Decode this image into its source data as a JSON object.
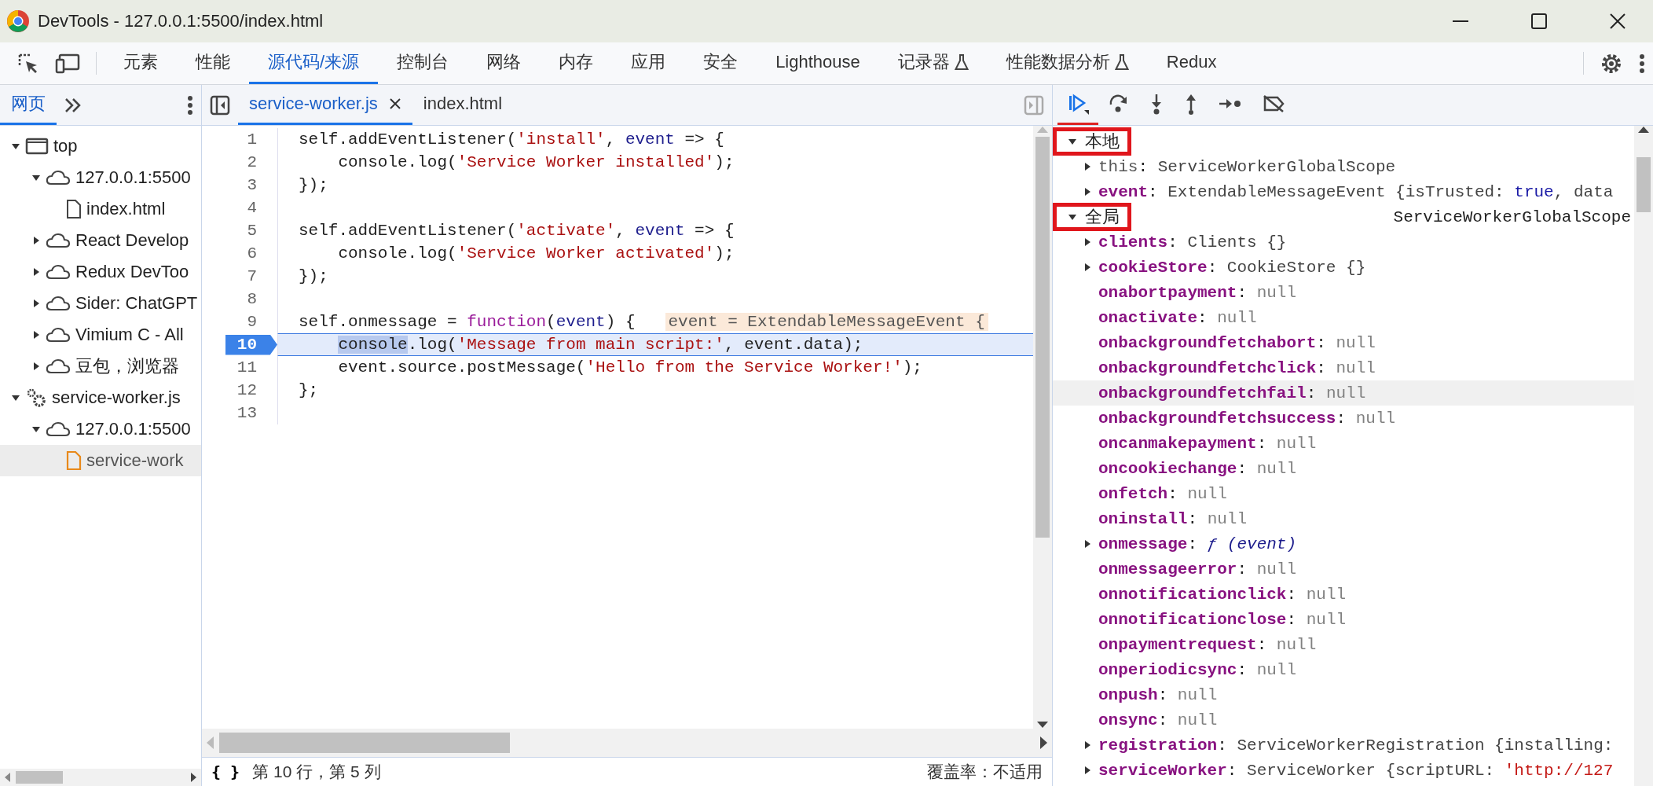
{
  "window": {
    "title": "DevTools - 127.0.0.1:5500/index.html"
  },
  "main_tabs": [
    {
      "label": "元素",
      "selected": false,
      "experimental": false
    },
    {
      "label": "性能",
      "selected": false,
      "experimental": false
    },
    {
      "label": "源代码/来源",
      "selected": true,
      "experimental": false
    },
    {
      "label": "控制台",
      "selected": false,
      "experimental": false
    },
    {
      "label": "网络",
      "selected": false,
      "experimental": false
    },
    {
      "label": "内存",
      "selected": false,
      "experimental": false
    },
    {
      "label": "应用",
      "selected": false,
      "experimental": false
    },
    {
      "label": "安全",
      "selected": false,
      "experimental": false
    },
    {
      "label": "Lighthouse",
      "selected": false,
      "experimental": false
    },
    {
      "label": "记录器",
      "selected": false,
      "experimental": true
    },
    {
      "label": "性能数据分析",
      "selected": false,
      "experimental": true
    },
    {
      "label": "Redux",
      "selected": false,
      "experimental": false
    }
  ],
  "navigator": {
    "tabs": [
      {
        "label": "网页",
        "selected": true
      }
    ],
    "tree": [
      {
        "label": "top",
        "kind": "frame",
        "expanded": true,
        "selected": false,
        "children": [
          {
            "label": "127.0.0.1:5500",
            "kind": "origin",
            "expanded": true,
            "selected": false,
            "children": [
              {
                "label": "index.html",
                "kind": "document",
                "selected": false
              }
            ]
          },
          {
            "label": "React Develop",
            "kind": "origin",
            "expanded": false,
            "selected": false
          },
          {
            "label": "Redux DevToo",
            "kind": "origin",
            "expanded": false,
            "selected": false
          },
          {
            "label": "Sider: ChatGPT",
            "kind": "origin",
            "expanded": false,
            "selected": false
          },
          {
            "label": "Vimium C - All",
            "kind": "origin",
            "expanded": false,
            "selected": false
          },
          {
            "label": "豆包，浏览器",
            "kind": "origin",
            "expanded": false,
            "selected": false
          }
        ]
      },
      {
        "label": "service-worker.js",
        "kind": "worker",
        "expanded": true,
        "selected": false,
        "children": [
          {
            "label": "127.0.0.1:5500",
            "kind": "origin",
            "expanded": true,
            "selected": false,
            "children": [
              {
                "label": "service-work",
                "kind": "script",
                "selected": true
              }
            ]
          }
        ]
      }
    ]
  },
  "editor": {
    "tabs": [
      {
        "label": "service-worker.js",
        "selected": true,
        "closable": true
      },
      {
        "label": "index.html",
        "selected": false,
        "closable": false
      }
    ],
    "lines": [
      {
        "number": "1",
        "paused": false,
        "tokens": [
          {
            "text": "self.addEventListener(",
            "kind": "plain"
          },
          {
            "text": "'install'",
            "kind": "string"
          },
          {
            "text": ", ",
            "kind": "plain"
          },
          {
            "text": "event",
            "kind": "variable"
          },
          {
            "text": " => {",
            "kind": "plain"
          }
        ]
      },
      {
        "number": "2",
        "paused": false,
        "tokens": [
          {
            "text": "    console.log(",
            "kind": "plain"
          },
          {
            "text": "'Service Worker installed'",
            "kind": "string"
          },
          {
            "text": ");",
            "kind": "plain"
          }
        ]
      },
      {
        "number": "3",
        "paused": false,
        "tokens": [
          {
            "text": "});",
            "kind": "plain"
          }
        ]
      },
      {
        "number": "4",
        "paused": false
      },
      {
        "number": "5",
        "paused": false,
        "tokens": [
          {
            "text": "self.addEventListener(",
            "kind": "plain"
          },
          {
            "text": "'activate'",
            "kind": "string"
          },
          {
            "text": ", ",
            "kind": "plain"
          },
          {
            "text": "event",
            "kind": "variable"
          },
          {
            "text": " => {",
            "kind": "plain"
          }
        ]
      },
      {
        "number": "6",
        "paused": false,
        "tokens": [
          {
            "text": "    console.log(",
            "kind": "plain"
          },
          {
            "text": "'Service Worker activated'",
            "kind": "string"
          },
          {
            "text": ");",
            "kind": "plain"
          }
        ]
      },
      {
        "number": "7",
        "paused": false,
        "tokens": [
          {
            "text": "});",
            "kind": "plain"
          }
        ]
      },
      {
        "number": "8",
        "paused": false
      },
      {
        "number": "9",
        "paused": false,
        "tokens": [
          {
            "text": "self.onmessage = ",
            "kind": "plain"
          },
          {
            "text": "function",
            "kind": "keyword"
          },
          {
            "text": "(",
            "kind": "plain"
          },
          {
            "text": "event",
            "kind": "variable"
          },
          {
            "text": ") {",
            "kind": "plain"
          }
        ],
        "inline_value": "event = ExtendableMessageEvent {"
      },
      {
        "number": "10",
        "paused": true,
        "tokens": [
          {
            "text": "    console",
            "kind": "selection"
          },
          {
            "text": ".log(",
            "kind": "plain"
          },
          {
            "text": "'Message from main script:'",
            "kind": "string"
          },
          {
            "text": ", event.data);",
            "kind": "plain"
          }
        ]
      },
      {
        "number": "11",
        "paused": false,
        "tokens": [
          {
            "text": "    event.source.postMessage(",
            "kind": "plain"
          },
          {
            "text": "'Hello from the Service Worker!'",
            "kind": "string"
          },
          {
            "text": ");",
            "kind": "plain"
          }
        ]
      },
      {
        "number": "12",
        "paused": false,
        "tokens": [
          {
            "text": "};",
            "kind": "plain"
          }
        ]
      },
      {
        "number": "13",
        "paused": false
      }
    ]
  },
  "status_bar": {
    "pretty_print": "{ }",
    "position": "第 10 行，第 5 列",
    "coverage": "覆盖率：不适用"
  },
  "scope": [
    {
      "title": "本地",
      "expanded": true,
      "highlighted": true,
      "items": [
        {
          "name": "this",
          "enumerable": false,
          "expandable": true,
          "hovered": false,
          "value": [
            {
              "text": ": ",
              "kind": "plain"
            },
            {
              "text": "ServiceWorkerGlobalScope",
              "kind": "object"
            }
          ]
        },
        {
          "name": "event",
          "enumerable": true,
          "expandable": true,
          "hovered": false,
          "value": [
            {
              "text": ": ",
              "kind": "plain"
            },
            {
              "text": "ExtendableMessageEvent {isTrusted: ",
              "kind": "object"
            },
            {
              "text": "true",
              "kind": "keyword"
            },
            {
              "text": ", data",
              "kind": "object"
            }
          ]
        }
      ]
    },
    {
      "title": "全局",
      "value": "ServiceWorkerGlobalScope",
      "expanded": true,
      "highlighted": true,
      "items": [
        {
          "name": "clients",
          "enumerable": true,
          "expandable": true,
          "hovered": false,
          "value": [
            {
              "text": ": ",
              "kind": "plain"
            },
            {
              "text": "Clients {}",
              "kind": "object"
            }
          ]
        },
        {
          "name": "cookieStore",
          "enumerable": true,
          "expandable": true,
          "hovered": false,
          "value": [
            {
              "text": ": ",
              "kind": "plain"
            },
            {
              "text": "CookieStore {}",
              "kind": "object"
            }
          ]
        },
        {
          "name": "onabortpayment",
          "enumerable": true,
          "expandable": false,
          "hovered": false,
          "value": [
            {
              "text": ": ",
              "kind": "plain"
            },
            {
              "text": "null",
              "kind": "null"
            }
          ]
        },
        {
          "name": "onactivate",
          "enumerable": true,
          "expandable": false,
          "hovered": false,
          "value": [
            {
              "text": ": ",
              "kind": "plain"
            },
            {
              "text": "null",
              "kind": "null"
            }
          ]
        },
        {
          "name": "onbackgroundfetchabort",
          "enumerable": true,
          "expandable": false,
          "hovered": false,
          "value": [
            {
              "text": ": ",
              "kind": "plain"
            },
            {
              "text": "null",
              "kind": "null"
            }
          ]
        },
        {
          "name": "onbackgroundfetchclick",
          "enumerable": true,
          "expandable": false,
          "hovered": false,
          "value": [
            {
              "text": ": ",
              "kind": "plain"
            },
            {
              "text": "null",
              "kind": "null"
            }
          ]
        },
        {
          "name": "onbackgroundfetchfail",
          "enumerable": true,
          "expandable": false,
          "hovered": true,
          "value": [
            {
              "text": ": ",
              "kind": "plain"
            },
            {
              "text": "null",
              "kind": "null"
            }
          ]
        },
        {
          "name": "onbackgroundfetchsuccess",
          "enumerable": true,
          "expandable": false,
          "hovered": false,
          "value": [
            {
              "text": ": ",
              "kind": "plain"
            },
            {
              "text": "null",
              "kind": "null"
            }
          ]
        },
        {
          "name": "oncanmakepayment",
          "enumerable": true,
          "expandable": false,
          "hovered": false,
          "value": [
            {
              "text": ": ",
              "kind": "plain"
            },
            {
              "text": "null",
              "kind": "null"
            }
          ]
        },
        {
          "name": "oncookiechange",
          "enumerable": true,
          "expandable": false,
          "hovered": false,
          "value": [
            {
              "text": ": ",
              "kind": "plain"
            },
            {
              "text": "null",
              "kind": "null"
            }
          ]
        },
        {
          "name": "onfetch",
          "enumerable": true,
          "expandable": false,
          "hovered": false,
          "value": [
            {
              "text": ": ",
              "kind": "plain"
            },
            {
              "text": "null",
              "kind": "null"
            }
          ]
        },
        {
          "name": "oninstall",
          "enumerable": true,
          "expandable": false,
          "hovered": false,
          "value": [
            {
              "text": ": ",
              "kind": "plain"
            },
            {
              "text": "null",
              "kind": "null"
            }
          ]
        },
        {
          "name": "onmessage",
          "enumerable": true,
          "expandable": true,
          "hovered": false,
          "value": [
            {
              "text": ": ",
              "kind": "plain"
            },
            {
              "text": "ƒ (event)",
              "kind": "function"
            }
          ]
        },
        {
          "name": "onmessageerror",
          "enumerable": true,
          "expandable": false,
          "hovered": false,
          "value": [
            {
              "text": ": ",
              "kind": "plain"
            },
            {
              "text": "null",
              "kind": "null"
            }
          ]
        },
        {
          "name": "onnotificationclick",
          "enumerable": true,
          "expandable": false,
          "hovered": false,
          "value": [
            {
              "text": ": ",
              "kind": "plain"
            },
            {
              "text": "null",
              "kind": "null"
            }
          ]
        },
        {
          "name": "onnotificationclose",
          "enumerable": true,
          "expandable": false,
          "hovered": false,
          "value": [
            {
              "text": ": ",
              "kind": "plain"
            },
            {
              "text": "null",
              "kind": "null"
            }
          ]
        },
        {
          "name": "onpaymentrequest",
          "enumerable": true,
          "expandable": false,
          "hovered": false,
          "value": [
            {
              "text": ": ",
              "kind": "plain"
            },
            {
              "text": "null",
              "kind": "null"
            }
          ]
        },
        {
          "name": "onperiodicsync",
          "enumerable": true,
          "expandable": false,
          "hovered": false,
          "value": [
            {
              "text": ": ",
              "kind": "plain"
            },
            {
              "text": "null",
              "kind": "null"
            }
          ]
        },
        {
          "name": "onpush",
          "enumerable": true,
          "expandable": false,
          "hovered": false,
          "value": [
            {
              "text": ": ",
              "kind": "plain"
            },
            {
              "text": "null",
              "kind": "null"
            }
          ]
        },
        {
          "name": "onsync",
          "enumerable": true,
          "expandable": false,
          "hovered": false,
          "value": [
            {
              "text": ": ",
              "kind": "plain"
            },
            {
              "text": "null",
              "kind": "null"
            }
          ]
        },
        {
          "name": "registration",
          "enumerable": true,
          "expandable": true,
          "hovered": false,
          "value": [
            {
              "text": ": ",
              "kind": "plain"
            },
            {
              "text": "ServiceWorkerRegistration {installing:",
              "kind": "object"
            }
          ]
        },
        {
          "name": "serviceWorker",
          "enumerable": true,
          "expandable": true,
          "hovered": false,
          "value": [
            {
              "text": ": ",
              "kind": "plain"
            },
            {
              "text": "ServiceWorker {scriptURL: ",
              "kind": "object"
            },
            {
              "text": "'http://127",
              "kind": "string"
            }
          ]
        }
      ]
    }
  ]
}
